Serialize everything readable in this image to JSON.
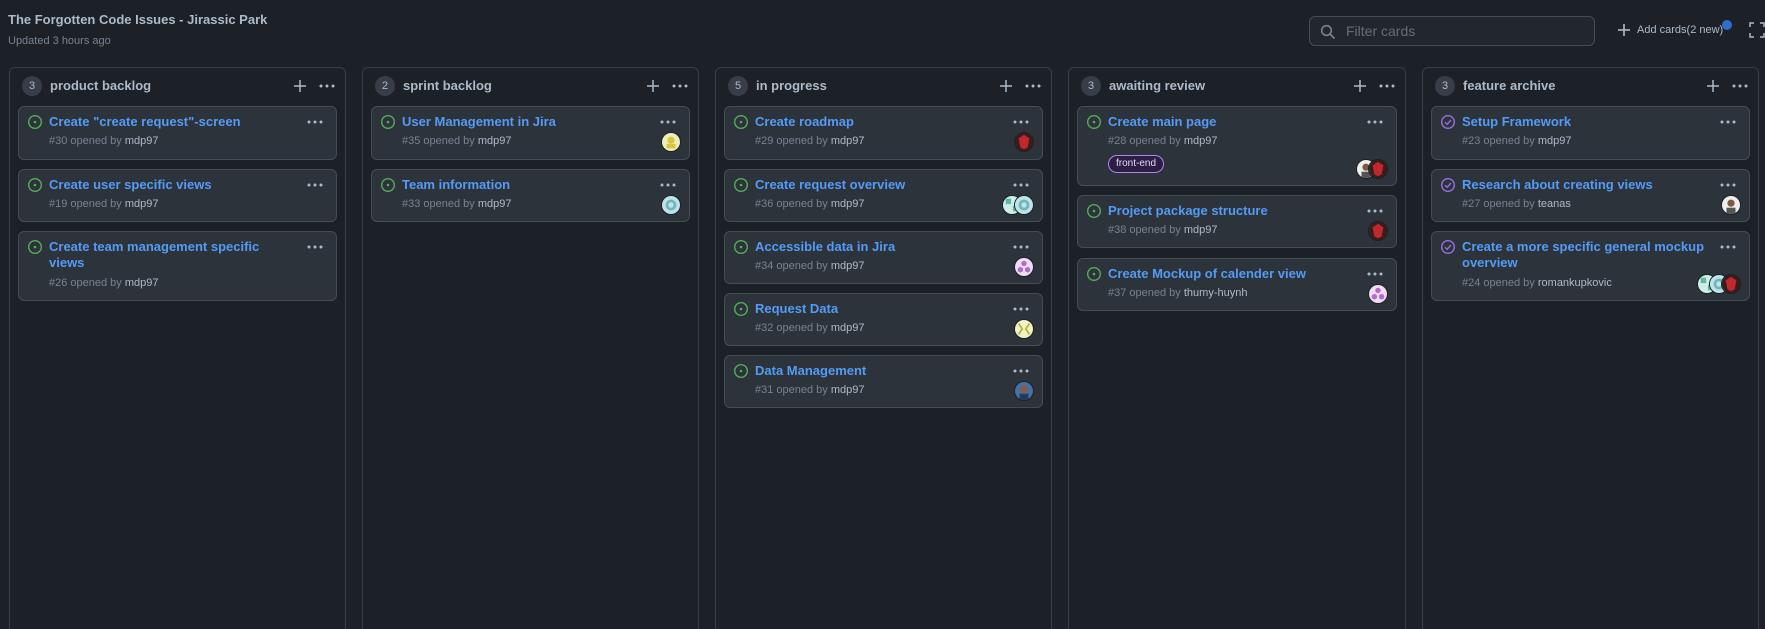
{
  "project": {
    "title": "The Forgotten Code Issues - Jirassic Park",
    "updated": "Updated 3 hours ago"
  },
  "filter": {
    "placeholder": "Filter cards",
    "icon": "search-icon"
  },
  "add_cards": {
    "label": "Add cards(2 new)"
  },
  "colors": {
    "accent": "#539bf5",
    "open": "#57ab5a",
    "closed": "#986ee2",
    "background": "#1c2128",
    "card": "#2d333b"
  },
  "columns": [
    {
      "name": "product backlog",
      "count": "3",
      "cards": [
        {
          "title": "Create \"create request\"-screen",
          "number": "#30",
          "opened_by": "opened by",
          "author": "mdp97",
          "state": "open"
        },
        {
          "title": "Create user specific views",
          "number": "#19",
          "opened_by": "opened by",
          "author": "mdp97",
          "state": "open"
        },
        {
          "title": "Create team management specific views",
          "number": "#26",
          "opened_by": "opened by",
          "author": "mdp97",
          "state": "open"
        }
      ]
    },
    {
      "name": "sprint backlog",
      "count": "2",
      "cards": [
        {
          "title": "User Management in Jira",
          "number": "#35",
          "opened_by": "opened by",
          "author": "mdp97",
          "state": "open"
        },
        {
          "title": "Team information",
          "number": "#33",
          "opened_by": "opened by",
          "author": "mdp97",
          "state": "open"
        }
      ]
    },
    {
      "name": "in progress",
      "count": "5",
      "cards": [
        {
          "title": "Create roadmap",
          "number": "#29",
          "opened_by": "opened by",
          "author": "mdp97",
          "state": "open"
        },
        {
          "title": "Create request overview",
          "number": "#36",
          "opened_by": "opened by",
          "author": "mdp97",
          "state": "open"
        },
        {
          "title": "Accessible data in Jira",
          "number": "#34",
          "opened_by": "opened by",
          "author": "mdp97",
          "state": "open"
        },
        {
          "title": "Request Data",
          "number": "#32",
          "opened_by": "opened by",
          "author": "mdp97",
          "state": "open"
        },
        {
          "title": "Data Management",
          "number": "#31",
          "opened_by": "opened by",
          "author": "mdp97",
          "state": "open"
        }
      ]
    },
    {
      "name": "awaiting review",
      "count": "3",
      "cards": [
        {
          "title": "Create main page",
          "number": "#28",
          "opened_by": "opened by",
          "author": "mdp97",
          "state": "open",
          "label": "front-end"
        },
        {
          "title": "Project package structure",
          "number": "#38",
          "opened_by": "opened by",
          "author": "mdp97",
          "state": "open"
        },
        {
          "title": "Create Mockup of calender view",
          "number": "#37",
          "opened_by": "opened by",
          "author": "thumy-huynh",
          "state": "open"
        }
      ]
    },
    {
      "name": "feature archive",
      "count": "3",
      "cards": [
        {
          "title": "Setup Framework",
          "number": "#23",
          "opened_by": "opened by",
          "author": "mdp97",
          "state": "closed"
        },
        {
          "title": "Research about creating views",
          "number": "#27",
          "opened_by": "opened by",
          "author": "teanas",
          "state": "closed"
        },
        {
          "title": "Create a more specific general mockup overview",
          "number": "#24",
          "opened_by": "opened by",
          "author": "romankupkovic",
          "state": "closed"
        }
      ]
    }
  ]
}
